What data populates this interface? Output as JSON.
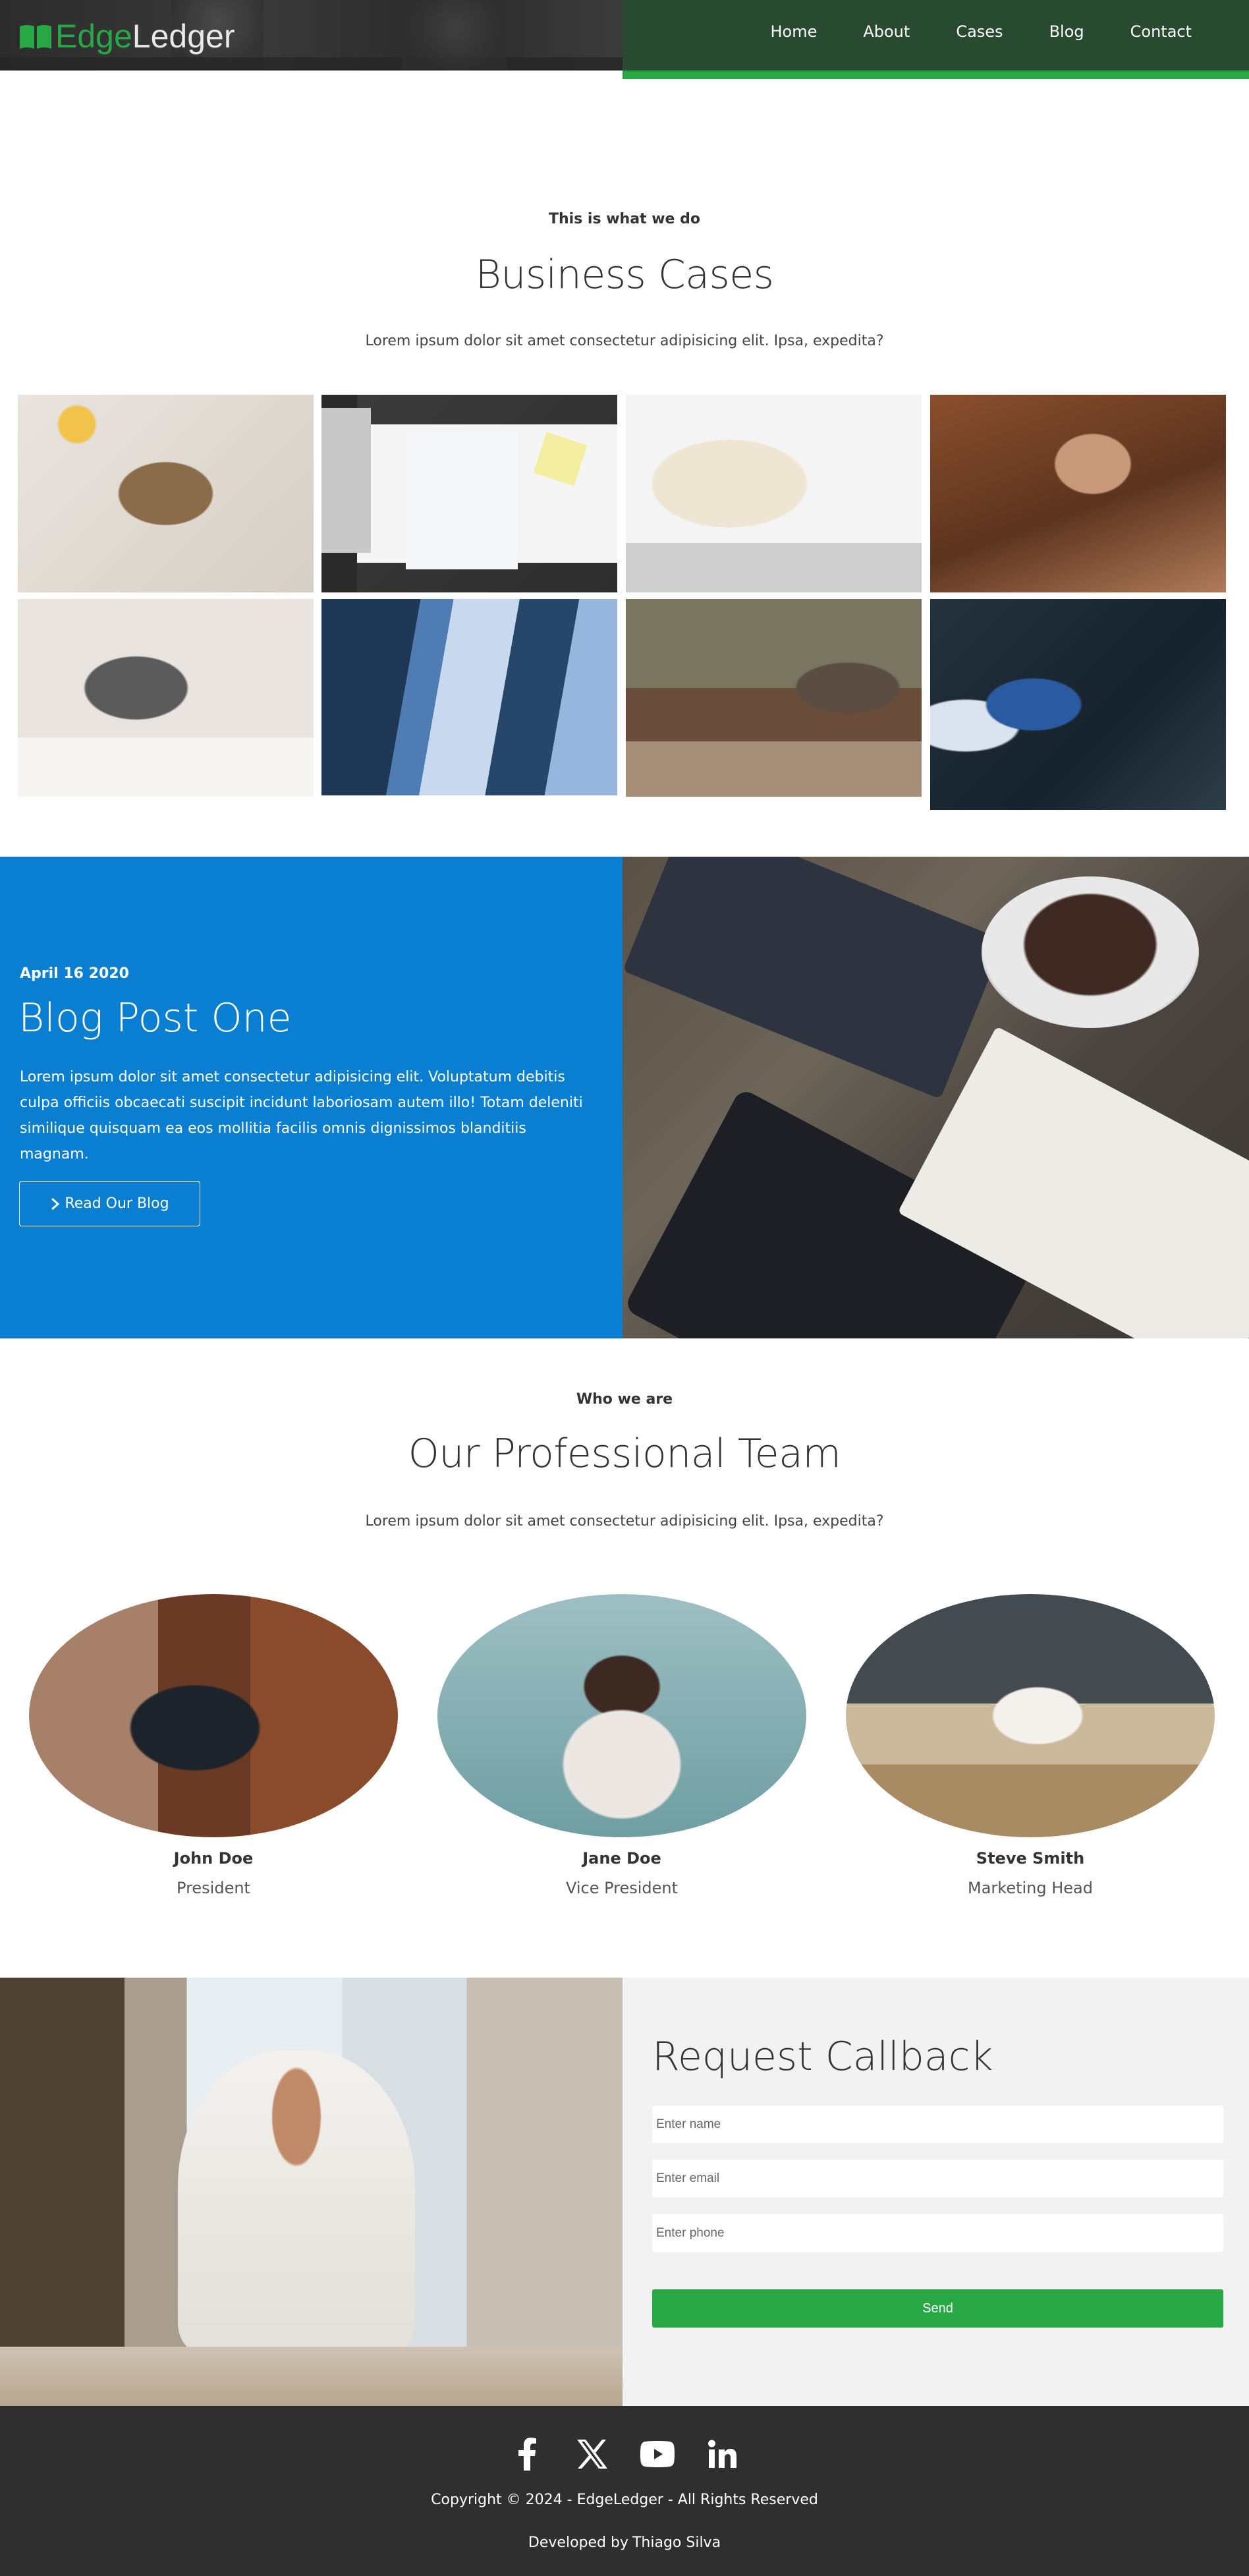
{
  "brand": {
    "part1": "Edge",
    "part2": "Ledger",
    "icon": "open-book-icon"
  },
  "nav": {
    "items": [
      "Home",
      "About",
      "Cases",
      "Blog",
      "Contact"
    ]
  },
  "cases": {
    "kicker": "This is what we do",
    "title": "Business Cases",
    "lead": "Lorem ipsum dolor sit amet consectetur adipisicing elit. Ipsa, expedita?"
  },
  "blog": {
    "date": "April 16 2020",
    "title": "Blog Post One",
    "text": "Lorem ipsum dolor sit amet consectetur adipisicing elit. Voluptatum debitis culpa officiis obcaecati suscipit incidunt laboriosam autem illo! Totam deleniti similique quisquam ea eos mollitia facilis omnis dignissimos blanditiis magnam.",
    "button_label": "Read Our Blog"
  },
  "team": {
    "kicker": "Who we are",
    "title": "Our Professional Team",
    "lead": "Lorem ipsum dolor sit amet consectetur adipisicing elit. Ipsa, expedita?",
    "members": [
      {
        "name": "John Doe",
        "role": "President"
      },
      {
        "name": "Jane Doe",
        "role": "Vice President"
      },
      {
        "name": "Steve Smith",
        "role": "Marketing Head"
      }
    ]
  },
  "callback": {
    "title": "Request Callback",
    "name_placeholder": "Enter name",
    "email_placeholder": "Enter email",
    "phone_placeholder": "Enter phone",
    "send_label": "Send"
  },
  "footer": {
    "socials": [
      "facebook-icon",
      "x-icon",
      "youtube-icon",
      "linkedin-icon"
    ],
    "copyright": "Copyright © 2024 - EdgeLedger - All Rights Reserved",
    "developed_by": "Developed by",
    "author": "Thiago Silva"
  },
  "colors": {
    "accent_green": "#28a745",
    "blog_blue": "#0a7ed0",
    "nav_green": "#274a31",
    "footer_bg": "#2f2f2f"
  }
}
